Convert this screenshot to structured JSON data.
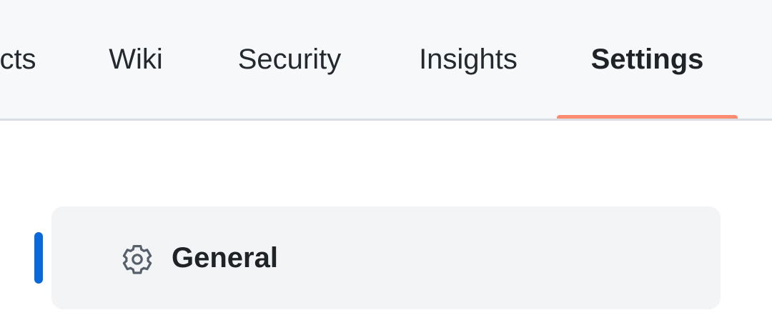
{
  "repo_nav": {
    "tabs": [
      {
        "label": "cts",
        "active": false
      },
      {
        "label": "Wiki",
        "active": false
      },
      {
        "label": "Security",
        "active": false
      },
      {
        "label": "Insights",
        "active": false
      },
      {
        "label": "Settings",
        "active": true
      }
    ],
    "underline_color": "#fd8c73"
  },
  "settings_menu": {
    "items": [
      {
        "label": "General",
        "icon": "gear-icon",
        "selected": true
      }
    ],
    "indicator_color": "#0969da"
  }
}
